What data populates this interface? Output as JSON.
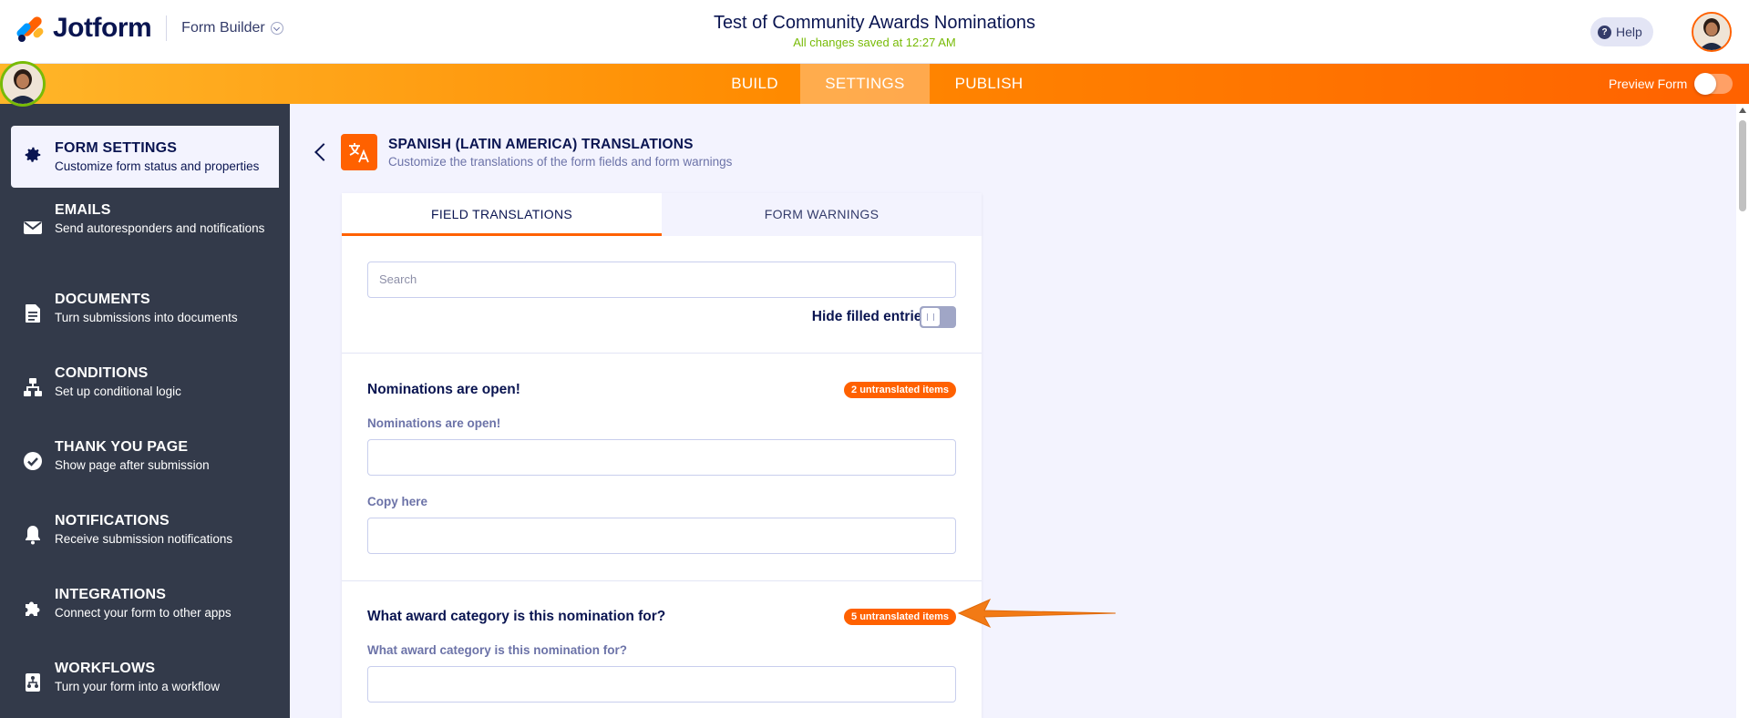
{
  "header": {
    "logo_text": "Jotform",
    "form_builder_label": "Form Builder",
    "form_title": "Test of Community Awards Nominations",
    "saved_status": "All changes saved at 12:27 AM",
    "help_label": "Help",
    "help_glyph": "?"
  },
  "nav": {
    "build": "BUILD",
    "settings": "SETTINGS",
    "publish": "PUBLISH",
    "preview_form": "Preview Form",
    "active_tab": "SETTINGS"
  },
  "sidebar": {
    "items": [
      {
        "title": "FORM SETTINGS",
        "desc": "Customize form status and properties",
        "icon": "gear-icon",
        "active": true
      },
      {
        "title": "EMAILS",
        "desc": "Send autoresponders and notifications",
        "icon": "envelope-icon"
      },
      {
        "title": "DOCUMENTS",
        "desc": "Turn submissions into documents",
        "icon": "document-icon"
      },
      {
        "title": "CONDITIONS",
        "desc": "Set up conditional logic",
        "icon": "hierarchy-icon"
      },
      {
        "title": "THANK YOU PAGE",
        "desc": "Show page after submission",
        "icon": "check-circle-icon"
      },
      {
        "title": "NOTIFICATIONS",
        "desc": "Receive submission notifications",
        "icon": "bell-icon"
      },
      {
        "title": "INTEGRATIONS",
        "desc": "Connect your form to other apps",
        "icon": "puzzle-icon"
      },
      {
        "title": "WORKFLOWS",
        "desc": "Turn your form into a workflow",
        "icon": "workflow-icon"
      }
    ]
  },
  "translations": {
    "title": "SPANISH (LATIN AMERICA) TRANSLATIONS",
    "subtitle": "Customize the translations of the form fields and form warnings",
    "icon": "translate-icon",
    "tabs": {
      "field": "FIELD TRANSLATIONS",
      "warnings": "FORM WARNINGS"
    },
    "search_placeholder": "Search",
    "hide_filled_label": "Hide filled entries",
    "sections": [
      {
        "title": "Nominations are open!",
        "badge": "2 untranslated items",
        "fields": [
          "Nominations are open!",
          "Copy here"
        ]
      },
      {
        "title": "What award category is this nomination for?",
        "badge": "5 untranslated items",
        "fields": [
          "What award category is this nomination for?"
        ]
      }
    ]
  },
  "colors": {
    "brand_orange": "#ff6100",
    "navy": "#0a1551",
    "sidebar_bg": "#333a4a",
    "saved_green": "#78bb07"
  }
}
